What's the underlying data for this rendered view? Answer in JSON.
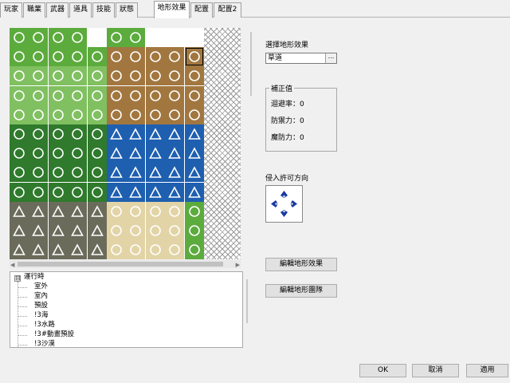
{
  "tabs": [
    {
      "label": "玩家",
      "active": false
    },
    {
      "label": "職業",
      "active": false
    },
    {
      "label": "武器",
      "active": false
    },
    {
      "label": "道具",
      "active": false
    },
    {
      "label": "技能",
      "active": false
    },
    {
      "label": "狀態",
      "active": false
    },
    {
      "label": "地形效果",
      "active": true
    },
    {
      "label": "配置",
      "active": false
    },
    {
      "label": "配置2",
      "active": false
    }
  ],
  "terrain_select": {
    "label": "選擇地形效果",
    "value": "草道",
    "button_label": "..."
  },
  "correction": {
    "title": "補正值",
    "evasion": "迴避率：0",
    "defense": "防禦力：0",
    "magic_defense": "魔防力：0"
  },
  "entry": {
    "label": "侵入許可方向"
  },
  "buttons": {
    "edit_terrain_effect": "編輯地形效果",
    "edit_terrain_group": "編輯地形團隊",
    "ok": "OK",
    "cancel": "取消",
    "apply": "適用"
  },
  "tree": {
    "root": "運行時",
    "root_toggle": "⊟",
    "children": [
      "室外",
      "室內",
      "預設",
      "!3海",
      "!3水路",
      "!3#動畫預設",
      "!3沙漠"
    ]
  },
  "colors": {
    "grass": "#5cab3d",
    "dirt": "#a2773f",
    "forest": "#2f7a2c",
    "water": "#1e5fb0",
    "sand": "#e2d4a6",
    "mountain": "#6b6b5b",
    "selected_outline": "#000000",
    "direction_marker": "#1a3aa0"
  },
  "icons": {
    "scroll_left": "◀",
    "scroll_right": "▶"
  }
}
